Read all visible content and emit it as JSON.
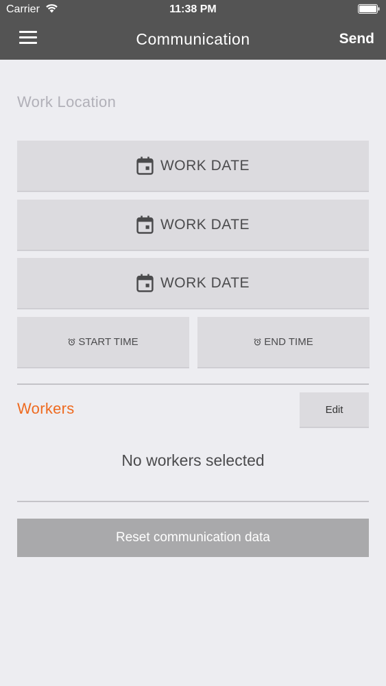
{
  "status_bar": {
    "carrier": "Carrier",
    "time": "11:38 PM"
  },
  "nav": {
    "title": "Communication",
    "send_label": "Send"
  },
  "form": {
    "work_location": "Work Location",
    "work_dates": [
      "WORK DATE",
      "WORK DATE",
      "WORK DATE"
    ],
    "start_time": "START TIME",
    "end_time": "END TIME"
  },
  "workers": {
    "label": "Workers",
    "edit_label": "Edit",
    "empty_text": "No workers selected"
  },
  "reset_label": "Reset communication data",
  "colors": {
    "header_bg": "#545454",
    "page_bg": "#ededf1",
    "button_bg": "#dcdbdf",
    "accent": "#ee6a1f",
    "reset_bg": "#a9a9ab"
  },
  "icons": [
    "wifi-icon",
    "battery-icon",
    "menu-icon",
    "calendar-icon",
    "alarm-clock-icon"
  ]
}
